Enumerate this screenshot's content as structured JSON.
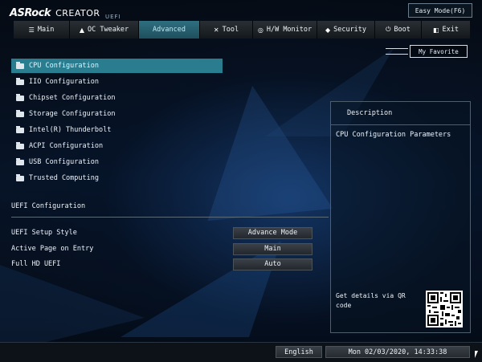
{
  "brand": {
    "logo": "ASRock",
    "model": "CREATOR",
    "sub": "UEFI"
  },
  "easy_mode": "Easy Mode(F6)",
  "tabs": [
    {
      "label": "Main",
      "icon": "list-icon"
    },
    {
      "label": "OC Tweaker",
      "icon": "flame-icon"
    },
    {
      "label": "Advanced",
      "icon": "",
      "active": true
    },
    {
      "label": "Tool",
      "icon": "tools-icon"
    },
    {
      "label": "H/W Monitor",
      "icon": "monitor-icon"
    },
    {
      "label": "Security",
      "icon": "shield-icon"
    },
    {
      "label": "Boot",
      "icon": "power-icon"
    },
    {
      "label": "Exit",
      "icon": "exit-icon"
    }
  ],
  "favorite": "My Favorite",
  "menu": [
    {
      "label": "CPU Configuration",
      "selected": true
    },
    {
      "label": "IIO Configuration"
    },
    {
      "label": "Chipset Configuration"
    },
    {
      "label": "Storage Configuration"
    },
    {
      "label": "Intel(R) Thunderbolt"
    },
    {
      "label": "ACPI Configuration"
    },
    {
      "label": "USB Configuration"
    },
    {
      "label": "Trusted Computing"
    }
  ],
  "uefi_section": {
    "title": "UEFI Configuration",
    "settings": [
      {
        "label": "UEFI Setup Style",
        "value": "Advance Mode"
      },
      {
        "label": "Active Page on Entry",
        "value": "Main"
      },
      {
        "label": "Full HD UEFI",
        "value": "Auto"
      }
    ]
  },
  "description": {
    "title": "Description",
    "text": "CPU Configuration Parameters",
    "qr_text": "Get details via QR code"
  },
  "footer": {
    "language": "English",
    "datetime": "Mon 02/03/2020, 14:33:38"
  }
}
